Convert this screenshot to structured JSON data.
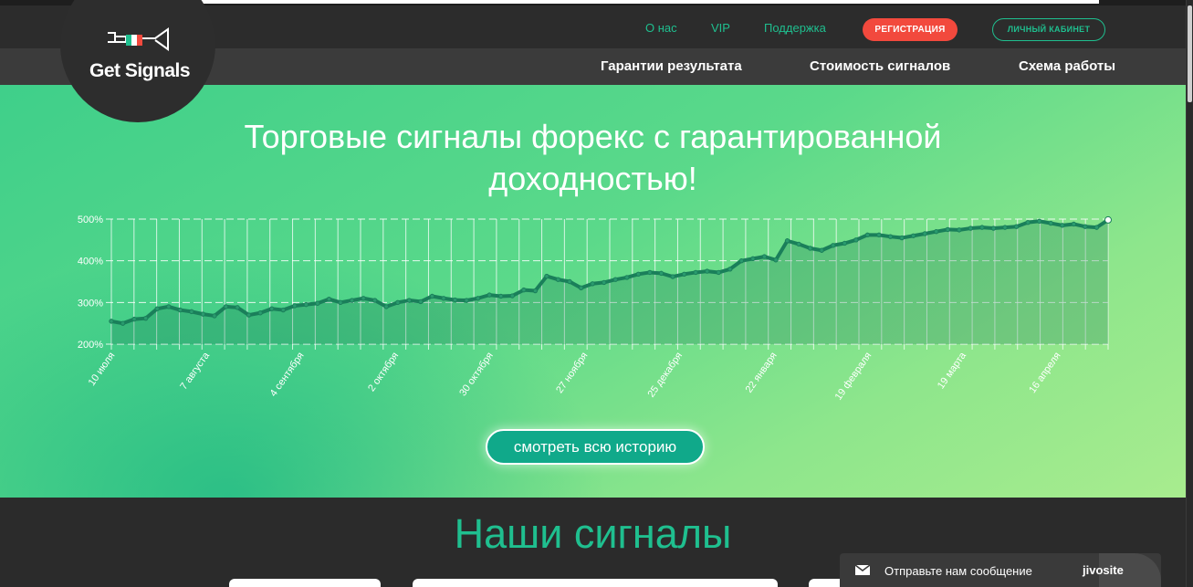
{
  "header": {
    "logo_text": "Get Signals",
    "top_links": [
      "О нас",
      "VIP",
      "Поддержка"
    ],
    "register_label": "РЕГИСТРАЦИЯ",
    "cabinet_label": "ЛИЧНЫЙ КАБИНЕТ",
    "nav": [
      "Гарантии результата",
      "Стоимость сигналов",
      "Схема работы"
    ]
  },
  "hero": {
    "title_line1": "Торговые сигналы форекс с гарантированной",
    "title_line2": "доходностью!",
    "history_button": "смотреть всю историю"
  },
  "chart_data": {
    "type": "line",
    "ylabel_ticks": [
      "200%",
      "300%",
      "400%",
      "500%"
    ],
    "ylim": [
      200,
      500
    ],
    "x_ticks": [
      "10 июля",
      "7 августа",
      "4 сентября",
      "2 октября",
      "30 октября",
      "27 ноября",
      "25 декабря",
      "22 января",
      "19 февраля",
      "19 марта",
      "16 апреля"
    ],
    "series": [
      {
        "points": [
          [
            0,
            255
          ],
          [
            1,
            250
          ],
          [
            2,
            260
          ],
          [
            3,
            262
          ],
          [
            4,
            285
          ],
          [
            5,
            290
          ],
          [
            6,
            282
          ],
          [
            7,
            278
          ],
          [
            8,
            272
          ],
          [
            9,
            268
          ],
          [
            10,
            290
          ],
          [
            11,
            288
          ],
          [
            12,
            270
          ],
          [
            13,
            275
          ],
          [
            14,
            285
          ],
          [
            15,
            282
          ],
          [
            16,
            292
          ],
          [
            17,
            295
          ],
          [
            18,
            298
          ],
          [
            19,
            308
          ],
          [
            20,
            300
          ],
          [
            21,
            305
          ],
          [
            22,
            310
          ],
          [
            23,
            305
          ],
          [
            24,
            290
          ],
          [
            25,
            300
          ],
          [
            26,
            305
          ],
          [
            27,
            302
          ],
          [
            28,
            315
          ],
          [
            29,
            310
          ],
          [
            30,
            306
          ],
          [
            31,
            305
          ],
          [
            32,
            310
          ],
          [
            33,
            318
          ],
          [
            34,
            315
          ],
          [
            35,
            316
          ],
          [
            36,
            330
          ],
          [
            37,
            328
          ],
          [
            38,
            363
          ],
          [
            39,
            355
          ],
          [
            40,
            350
          ],
          [
            41,
            335
          ],
          [
            42,
            345
          ],
          [
            43,
            348
          ],
          [
            44,
            355
          ],
          [
            45,
            360
          ],
          [
            46,
            368
          ],
          [
            47,
            372
          ],
          [
            48,
            370
          ],
          [
            49,
            362
          ],
          [
            50,
            368
          ],
          [
            51,
            372
          ],
          [
            52,
            375
          ],
          [
            53,
            372
          ],
          [
            54,
            380
          ],
          [
            55,
            400
          ],
          [
            56,
            405
          ],
          [
            57,
            410
          ],
          [
            58,
            402
          ],
          [
            59,
            448
          ],
          [
            60,
            440
          ],
          [
            61,
            430
          ],
          [
            62,
            425
          ],
          [
            63,
            437
          ],
          [
            64,
            442
          ],
          [
            65,
            450
          ],
          [
            66,
            462
          ],
          [
            67,
            462
          ],
          [
            68,
            458
          ],
          [
            69,
            455
          ],
          [
            70,
            460
          ],
          [
            71,
            465
          ],
          [
            72,
            470
          ],
          [
            73,
            475
          ],
          [
            74,
            474
          ],
          [
            75,
            478
          ],
          [
            76,
            480
          ],
          [
            77,
            478
          ],
          [
            78,
            480
          ],
          [
            79,
            482
          ],
          [
            80,
            492
          ],
          [
            81,
            495
          ],
          [
            82,
            490
          ],
          [
            83,
            485
          ],
          [
            84,
            488
          ],
          [
            85,
            482
          ],
          [
            86,
            480
          ],
          [
            87,
            498
          ]
        ]
      }
    ]
  },
  "signals": {
    "title": "Наши сигналы"
  },
  "chat": {
    "text": "Отправьте нам сообщение",
    "brand": "jivosite"
  },
  "colors": {
    "accent": "#1fbf8f",
    "register": "#f2493d",
    "line": "#1a7f5a"
  }
}
